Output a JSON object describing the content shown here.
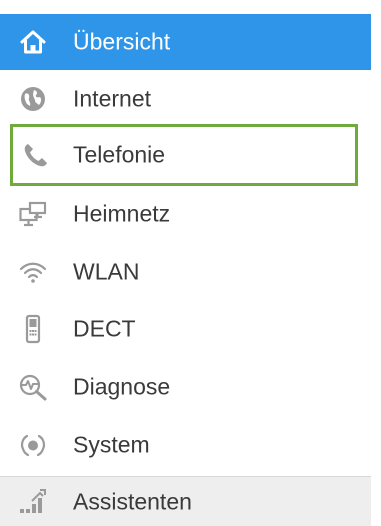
{
  "menu": {
    "items": [
      {
        "label": "Übersicht",
        "icon": "home-icon",
        "state": "active"
      },
      {
        "label": "Internet",
        "icon": "globe-icon",
        "state": "normal"
      },
      {
        "label": "Telefonie",
        "icon": "phone-icon",
        "state": "focused"
      },
      {
        "label": "Heimnetz",
        "icon": "network-icon",
        "state": "normal"
      },
      {
        "label": "WLAN",
        "icon": "wifi-icon",
        "state": "normal"
      },
      {
        "label": "DECT",
        "icon": "dect-phone-icon",
        "state": "normal"
      },
      {
        "label": "Diagnose",
        "icon": "diagnosis-icon",
        "state": "normal"
      },
      {
        "label": "System",
        "icon": "system-icon",
        "state": "normal"
      },
      {
        "label": "Assistenten",
        "icon": "assistant-icon",
        "state": "normal"
      }
    ]
  },
  "colors": {
    "active_background": "#2f95e8",
    "focus_outline": "#6eaa3c",
    "text": "#3a3a3a",
    "icon": "#9a9a9a",
    "assistant_background": "#eeeeee"
  }
}
